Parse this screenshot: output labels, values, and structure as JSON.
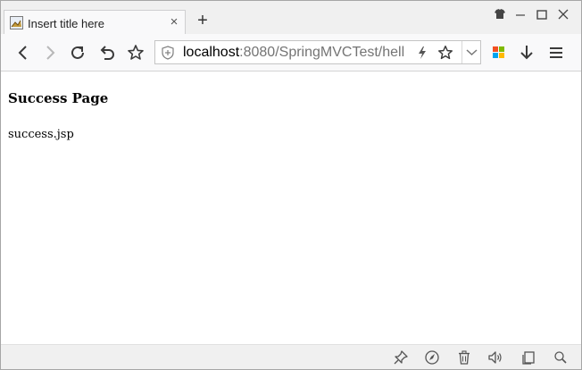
{
  "tab": {
    "title": "Insert title here",
    "close_glyph": "×",
    "favicon": "page-favicon-icon"
  },
  "tabstrip": {
    "new_tab_glyph": "+"
  },
  "window_controls": [
    "shirt-theme-icon",
    "minimize-icon",
    "maximize-icon",
    "close-icon"
  ],
  "toolbar": {
    "buttons": [
      "back-icon",
      "forward-icon",
      "reload-icon",
      "undo-icon",
      "star-icon"
    ],
    "url_host": "localhost",
    "url_rest": ":8080/SpringMVCTest/hell",
    "right_buttons": [
      "extension-grid-icon",
      "download-icon",
      "menu-icon"
    ]
  },
  "page": {
    "heading": "Success Page",
    "text": "success.jsp"
  },
  "statusbar": {
    "buttons": [
      "pin-icon",
      "compass-icon",
      "trash-icon",
      "volume-icon",
      "window-icon",
      "zoom-icon"
    ]
  },
  "colors": {
    "tabstrip_bg": "#f0f0f0",
    "toolbar_bg": "#f9f9fa",
    "icon": "#3a3a3a",
    "disabled_icon": "#b8b8b8"
  }
}
